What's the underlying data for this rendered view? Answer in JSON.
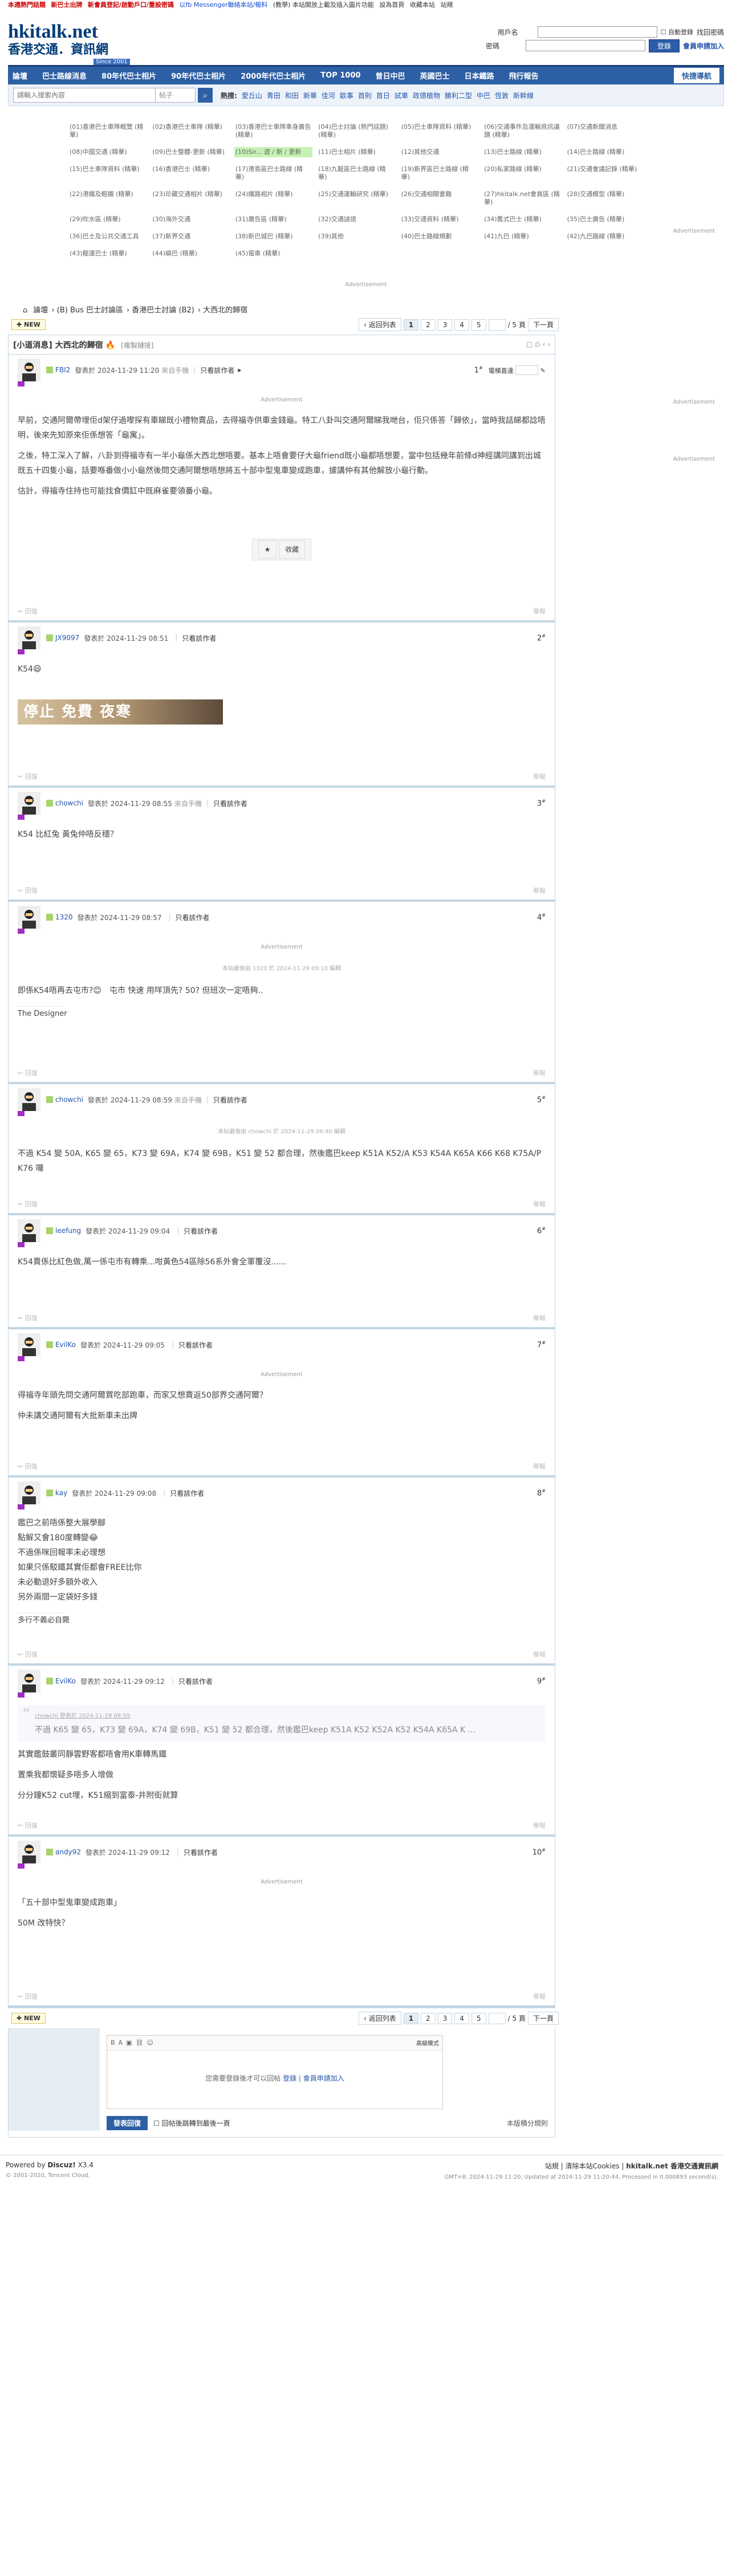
{
  "topbar": {
    "items": [
      "本週熱門話題",
      "新巴士出牌",
      "新會員登記/啟動戶口/重設密碼",
      "以fb Messenger聯絡本站/報料",
      "(教學) 本站開放上載及插入圖片功能",
      "設為首頁",
      "收藏本站",
      "站規"
    ]
  },
  "logo": {
    "line1": "hkitalk.net",
    "line2": "香港交通．資訊網",
    "line3": "Since 2001"
  },
  "login": {
    "user_label": "用戶名",
    "pass_label": "密碼",
    "auto": "自動登錄",
    "forgot": "找回密碼",
    "login_btn": "登錄",
    "register": "會員申請加入"
  },
  "nav": {
    "items": [
      "論壇",
      "巴士路線消息",
      "80年代巴士相片",
      "90年代巴士相片",
      "2000年代巴士相片",
      "TOP 1000",
      "曾日中巴",
      "英國巴士",
      "日本鐵路",
      "飛行報告"
    ],
    "quick": "快捷導航"
  },
  "search": {
    "placeholder": "請輸入搜索內容",
    "type": "帖子",
    "hot_label": "熱搜:",
    "hot": [
      "愛丘山",
      "青田",
      "和田",
      "新華",
      "佳河",
      "歐事",
      "首則",
      "首日",
      "試車",
      "政德植物",
      "勝利二型",
      "中巴",
      "恆敦",
      "新幹線"
    ]
  },
  "links": [
    "(01)香港巴士車隊概覽 (精華)",
    "(02)香港巴士車隊 (精華)",
    "(03)香港巴士車隊車身廣告 (精華)",
    "(04)巴士討論 (熱門話題) (精華)",
    "(05)巴士車隊資料 (精華)",
    "(06)交通事件及運輸資訊議題 (精華)",
    "(07)交通新聞消息",
    "(08)中國交通 (精華)",
    "(09)巴士整體-更新 (精華)",
    "(10)Sir... 遊 / 新 / 更新",
    "(11)巴士相片 (精華)",
    "(12)其他交通",
    "(13)巴士路線 (精華)",
    "(14)巴士路線 (精華)",
    "(15)巴士車隊資料 (精華)",
    "(16)香港巴士 (精華)",
    "(17)港島區巴士路線 (精華)",
    "(18)九龍區巴士路線 (精華)",
    "(19)新界區巴士路線 (精華)",
    "(20)私家路線 (精華)",
    "(21)交通會議記錄 (精華)",
    "(22)港鐵及輕鐵 (精華)",
    "(23)珍藏交通相片 (精華)",
    "(24)鐵路相片 (精華)",
    "(25)交通運輸研究 (精華)",
    "(26)交通相關書籍",
    "(27)hkitalk.net會員區 (精華)",
    "(28)交通模型 (精華)",
    "(29)吹水區 (精華)",
    "(30)海外交通",
    "(31)廣告區 (精華)",
    "(32)交通謎語",
    "(33)交通資料 (精華)",
    "(34)舊式巴士 (精華)",
    "(35)巴士廣告 (精華)",
    "(36)巴士及公共交通工具",
    "(37)新界交通",
    "(38)新巴城巴 (精華)",
    "(39)其他",
    "(40)巴士路線規劃",
    "(41)九巴 (精華)",
    "(42)九巴路線 (精華)",
    "(43)龍運巴士 (精華)",
    "(44)嶼巴 (精華)",
    "(45)電車 (精華)"
  ],
  "links_highlight": "(10)Sir... 遊 / 新 / 更新",
  "ad_label": "Advertisement",
  "crumb": [
    "論壇",
    "(B) Bus 巴士討論區",
    "香港巴士討論 (B2)",
    "大西北的歸宿"
  ],
  "new_btn": "NEW",
  "pager": {
    "back": "返回列表",
    "pages": [
      "1",
      "2",
      "3",
      "4",
      "5"
    ],
    "current": "1",
    "total": "/ 5 頁",
    "next": "下一頁"
  },
  "thread": {
    "views_label": "查看:",
    "title": "[小道消息] 大西北的歸宿",
    "copy": "[複製鏈接]"
  },
  "posts": [
    {
      "user": "FBI2",
      "time": "發表於 2024-11-29 11:20",
      "src": "來自手機",
      "only": "只看該作者",
      "floor": "1",
      "extra": "電梯直達",
      "body": [
        "早前，交通阿爾帶埋佢d架仔過嚟探有車睇既小禮物賣品，去得福寺供車金錢龜。特工八卦叫交通阿爾睇我哋台，佢只係答「歸依」，當時我話睇都諗唔明，後來先知原來佢係想答「龜寓」。",
        "之後，特工深入了解，八卦到得福寺有一半小龜係大西北想唔要。基本上唔會要仔大龜friend既小龜都唔想要，當中包括幾年前條d神經講同講到出城既五十四隻小龜，話要喺番做小小龜然後問交通阿爾想唔想將五十部中型鬼車變成跑車，據講仲有其他解放小龜行動。",
        "估計，得福寺住持也可能找食價缸中既麻雀要領番小龜。"
      ],
      "fav": "收藏"
    },
    {
      "user": "JX9097",
      "time": "發表於 2024-11-29 08:51",
      "src": "",
      "only": "只看該作者",
      "floor": "2",
      "body": [
        "K54😄"
      ],
      "banner": "停止 免費 夜寒"
    },
    {
      "user": "chowchi",
      "time": "發表於 2024-11-29 08:55",
      "src": "來自手機",
      "only": "只看該作者",
      "floor": "3",
      "body": [
        "K54 比紅兔 黃兔仲唔反穩？"
      ]
    },
    {
      "user": "1320",
      "time": "發表於 2024-11-29 08:57",
      "src": "",
      "only": "只看該作者",
      "floor": "4",
      "edit": "本帖最後由 1320 於 2024-11-29 09:10 編輯",
      "body": [
        "即係K54唔再去屯市?😊　屯市 快速 用咩頂先? 50? 但班次一定唔夠.."
      ],
      "sig": "The Designer"
    },
    {
      "user": "chowchi",
      "time": "發表於 2024-11-29 08:59",
      "src": "來自手機",
      "only": "只看該作者",
      "floor": "5",
      "edit": "本帖最後由 chowchi 於 2024-11-29 09:40 編輯",
      "body": [
        "不過 K54 變 50A, K65 變 65，K73 變 69A，K74 變 69B，K51 變 52 都合理，然後鑑巴keep K51A K52/A K53 K54A K65A K66 K68 K75A/P K76 囉"
      ]
    },
    {
      "user": "leefung",
      "time": "發表於 2024-11-29 09:04",
      "src": "",
      "only": "只看該作者",
      "floor": "6",
      "body": [
        "K54賣係比紅色做,萬一係屯市有轉乘...咁黃色54區除56系外會全軍覆沒......"
      ]
    },
    {
      "user": "EvilKo",
      "time": "發表於 2024-11-29 09:05",
      "src": "",
      "only": "只看該作者",
      "floor": "7",
      "body": [
        "得福寺年頭先問交通阿爾買吃部跑車，而家又想賣返50部界交通阿爾？",
        "仲未講交通阿爾有大批新車未出牌"
      ]
    },
    {
      "user": "kay",
      "time": "發表於 2024-11-29 09:08",
      "src": "",
      "only": "只看該作者",
      "floor": "8",
      "body": [
        "鑑巴之前唔係整大展學腳",
        "點解又會180度轉變😂",
        "",
        "不過係咪回報率未必理想",
        "如果只係駁鐵其實佢都會FREE比你",
        "未必動退好多額外收入",
        "",
        "另外兩間一定袋好多錢"
      ],
      "sig": "多行不義必自斃"
    },
    {
      "user": "EvilKo",
      "time": "發表於 2024-11-29 09:12",
      "src": "",
      "only": "只看該作者",
      "floor": "9",
      "quote_head": "chowchi 發表於 2024-11-29 08:59",
      "quote": "不過 K65 變 65，K73 變 69A，K74 變 69B，K51 變 52 都合理，然後鑑巴keep K51A K52 K52A K52 K54A K65A K ...",
      "body": [
        "其實鑑鼓叢同靜雲野客都唔會用K車轉馬鐵",
        "置乘我都懷疑多唔多人增做",
        "分分鐘K52 cut埋，K51縮到富泰-井附街就算"
      ]
    },
    {
      "user": "andy92",
      "time": "發表於 2024-11-29 09:12",
      "src": "",
      "only": "只看該作者",
      "floor": "10",
      "body": [
        "「五十部中型鬼車變成跑車」",
        "50M 改特快？"
      ]
    }
  ],
  "post_foot": {
    "left": "回復",
    "right": "舉報"
  },
  "reply": {
    "advanced": "高級模式",
    "tip": "您需要登錄後才可以回帖",
    "login": "登錄",
    "reg": "會員申請加入",
    "post": "發表回復",
    "check": "回帖後跳轉到最後一頁",
    "right": "本版積分規則"
  },
  "footer": {
    "powered": "Powered by",
    "discuz": "Discuz!",
    "ver": "X3.4",
    "copy": "© 2001-2020, Tencent Cloud.",
    "links": "站規 | 清除本站Cookies |",
    "site": "hkitalk.net 香港交通資訊網",
    "time": "GMT+8, 2024-11-29 11:20, Updated at 2024-11-29 11:20:44, Processed in 0.000893 second(s)."
  }
}
